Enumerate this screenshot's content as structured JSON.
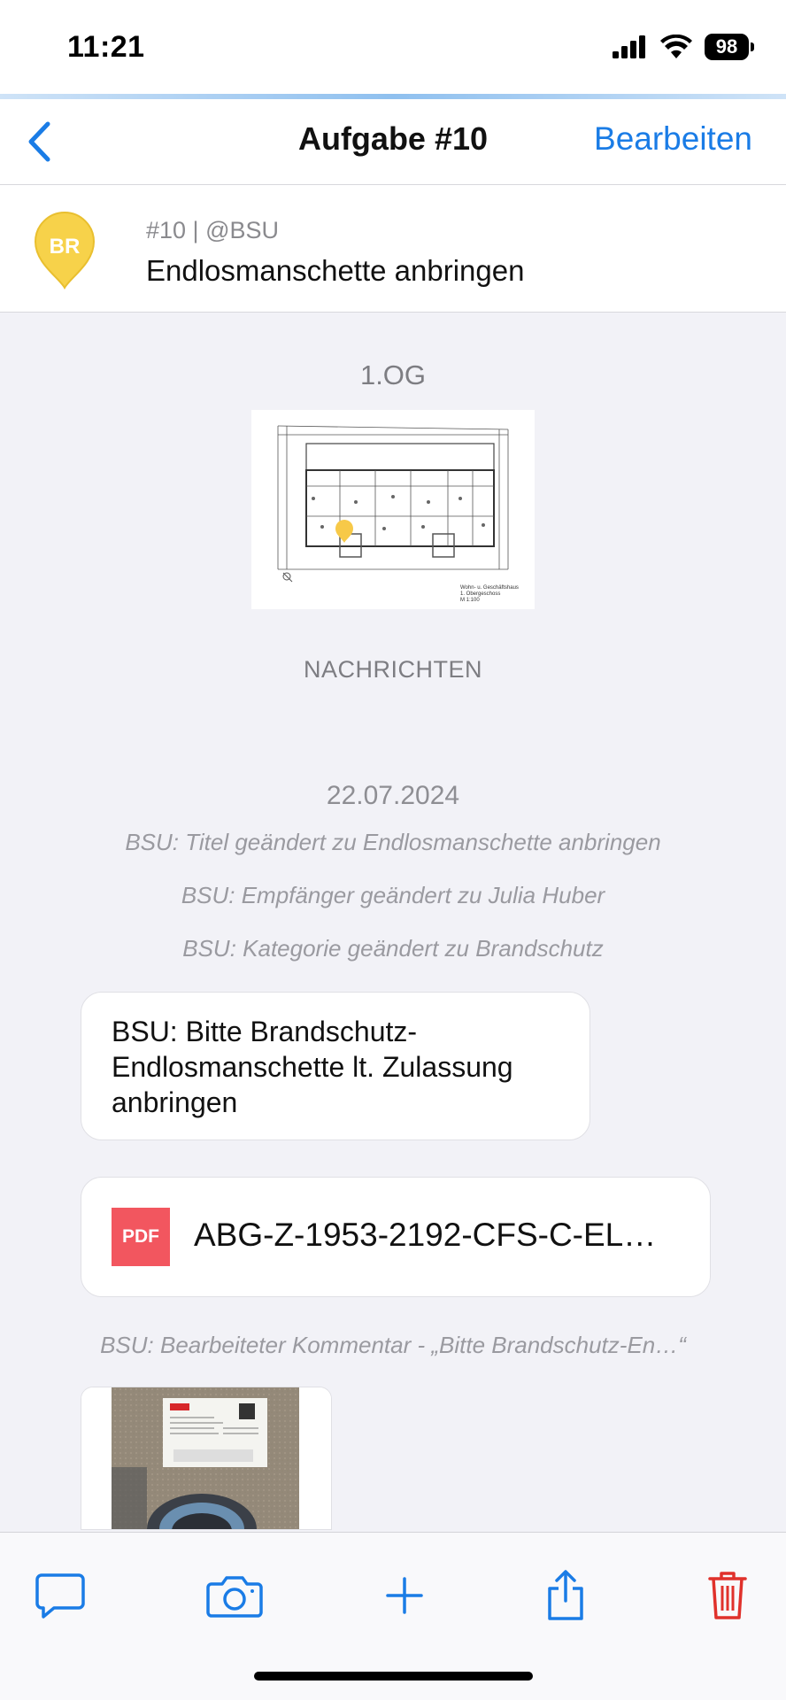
{
  "status_bar": {
    "time": "11:21",
    "battery": "98"
  },
  "nav": {
    "title": "Aufgabe #10",
    "edit_label": "Bearbeiten",
    "back_icon": "chevron-left-icon"
  },
  "task": {
    "pin_initials": "BR",
    "pin_color": "#f7d24a",
    "meta": "#10 | @BSU",
    "title": "Endlosmanschette anbringen"
  },
  "plan": {
    "floor": "1.OG",
    "caption_lines": [
      "Wohn- u. Geschäftshaus",
      "1. Obergeschoss",
      "M 1:100"
    ]
  },
  "messages": {
    "section_title": "NACHRICHTEN",
    "date": "22.07.2024",
    "events": [
      "BSU: Titel geändert zu Endlosmanschette anbringen",
      "BSU: Empfänger geändert zu Julia Huber",
      "BSU: Kategorie geändert zu Brandschutz"
    ],
    "comment_lines": [
      "BSU: Bitte Brandschutz-",
      "Endlosmanschette lt. Zulassung",
      "anbringen"
    ],
    "attachment": {
      "type_label": "PDF",
      "name": "ABG-Z-1953-2192-CFS-C-EL…"
    },
    "edited_note": "BSU: Bearbeiteter Kommentar - „Bitte Brandschutz-En…“"
  },
  "toolbar": {
    "items": [
      "comment-icon",
      "camera-icon",
      "plus-icon",
      "share-icon",
      "trash-icon"
    ],
    "accent": "#1a7ce6",
    "danger": "#e0312b"
  }
}
